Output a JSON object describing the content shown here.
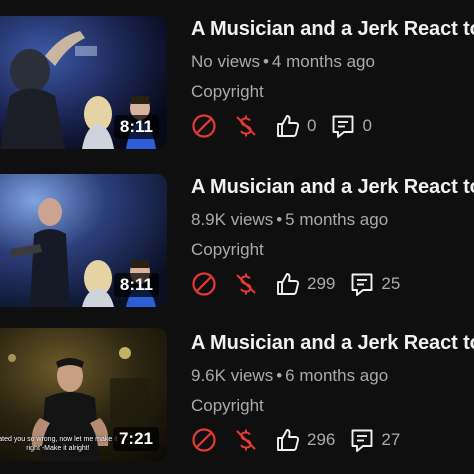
{
  "videos": [
    {
      "title": "A Musician and a Jerk React to",
      "views": "No views",
      "age": "4 months ago",
      "restriction": "Copyright",
      "duration": "8:11",
      "likes": "0",
      "comments": "0",
      "subtitle": ""
    },
    {
      "title": "A Musician and a Jerk React to",
      "views": "8.9K views",
      "age": "5 months ago",
      "restriction": "Copyright",
      "duration": "8:11",
      "likes": "299",
      "comments": "25",
      "subtitle": ""
    },
    {
      "title": "A Musician and a Jerk React to",
      "views": "9.6K views",
      "age": "6 months ago",
      "restriction": "Copyright",
      "duration": "7:21",
      "likes": "296",
      "comments": "27",
      "subtitle": "ated you so wrong, now let me make it right -Make it alright!"
    }
  ],
  "meta_separator": "•",
  "colors": {
    "background": "#0f0f0f",
    "title": "#f1f1f1",
    "secondary": "#aaaaaa",
    "restriction_red": "#e53935"
  },
  "icons": {
    "restriction": "blocked-circle-icon",
    "monetization": "dollar-off-icon",
    "likes": "thumbs-up-icon",
    "comments": "comment-icon"
  }
}
